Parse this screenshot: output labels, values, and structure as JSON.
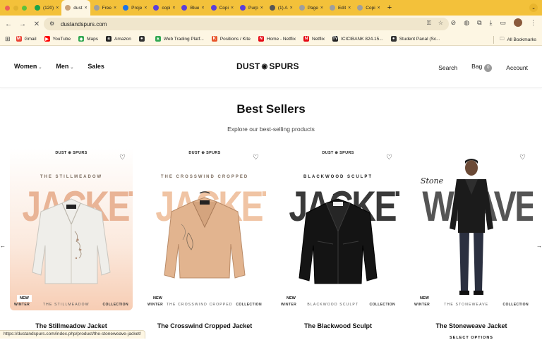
{
  "browser": {
    "tabs": [
      {
        "title": "(120)",
        "color": "#1aa34a"
      },
      {
        "title": "dust",
        "color": "#c9a27a",
        "active": true
      },
      {
        "title": "Free",
        "color": "#9e9e9e"
      },
      {
        "title": "Proje",
        "color": "#1a73e8"
      },
      {
        "title": "copi",
        "color": "#5b3fd9"
      },
      {
        "title": "Blue",
        "color": "#5b3fd9"
      },
      {
        "title": "Copi",
        "color": "#5b3fd9"
      },
      {
        "title": "Purp",
        "color": "#5b3fd9"
      },
      {
        "title": "(1) A",
        "color": "#555555"
      },
      {
        "title": "Page",
        "color": "#9e9e9e"
      },
      {
        "title": "Edit",
        "color": "#9e9e9e"
      },
      {
        "title": "Copi",
        "color": "#9e9e9e"
      }
    ],
    "url": "dustandspurs.com",
    "bookmarks": [
      {
        "label": "Gmail",
        "color": "#ea4335",
        "glyph": "M"
      },
      {
        "label": "YouTube",
        "color": "#ff0000",
        "glyph": "▶"
      },
      {
        "label": "Maps",
        "color": "#34a853",
        "glyph": "◆"
      },
      {
        "label": "Amazon",
        "color": "#222222",
        "glyph": "a"
      },
      {
        "label": "",
        "color": "#333333",
        "glyph": "●"
      },
      {
        "label": "Web Trading Platf...",
        "color": "#34a853",
        "glyph": "▲"
      },
      {
        "label": "Positions / Kite",
        "color": "#e8552b",
        "glyph": "K"
      },
      {
        "label": "Home - Netflix",
        "color": "#e50914",
        "glyph": "N"
      },
      {
        "label": "Netflix",
        "color": "#e50914",
        "glyph": "N"
      },
      {
        "label": "ICICIBANK 824.15...",
        "color": "#222222",
        "glyph": "TV"
      },
      {
        "label": "Student Panal (Sc...",
        "color": "#333333",
        "glyph": "●"
      }
    ],
    "all_bookmarks": "All Bookmarks",
    "status_url": "https://dustandspurs.com/index.php/product/the-stoneweave-jacket/"
  },
  "site": {
    "nav_left": [
      "Women",
      "Men",
      "Sales"
    ],
    "logo_left": "DUST",
    "logo_right": "SPURS",
    "nav_search": "Search",
    "nav_bag": "Bag",
    "bag_count": "0",
    "nav_account": "Account"
  },
  "section": {
    "title": "Best Sellers",
    "subtitle": "Explore our best-selling products"
  },
  "products": [
    {
      "name": "The Stillmeadow Jacket",
      "brand_mark": "DUST ⊕ SPURS",
      "tagline": "THE STILLMEADOW",
      "big_word": "JACKET",
      "big_color": "#e9b496",
      "badge": "NEW",
      "strip_left": "WINTER",
      "strip_mid": "THE STILLMEADOW",
      "strip_right": "COLLECTION"
    },
    {
      "name": "The Crosswind Cropped Jacket",
      "brand_mark": "DUST ⊕ SPURS",
      "tagline": "THE CROSSWIND CROPPED",
      "big_word": "JACKET",
      "big_color": "#f0c4a4",
      "badge": "NEW",
      "strip_left": "WINTER",
      "strip_mid": "THE CROSSWIND CROPPED",
      "strip_right": "COLLECTION"
    },
    {
      "name": "The Blackwood Sculpt",
      "brand_mark": "DUST ⊕ SPURS",
      "tagline": "BLACKWOOD SCULPT",
      "big_word": "JACKET",
      "big_color": "#3a3a3a",
      "badge": "NEW",
      "strip_left": "WINTER",
      "strip_mid": "BLACKWOOD SCULPT",
      "strip_right": "COLLECTION"
    },
    {
      "name": "The Stoneweave Jacket",
      "brand_mark": "",
      "tagline": "Stone",
      "big_word": "WEAVE",
      "big_color": "#555555",
      "badge": "NEW",
      "strip_left": "WINTER",
      "strip_mid": "THE STONEWEAVE",
      "strip_right": "COLLECTION",
      "select_options": "SELECT OPTIONS"
    }
  ]
}
